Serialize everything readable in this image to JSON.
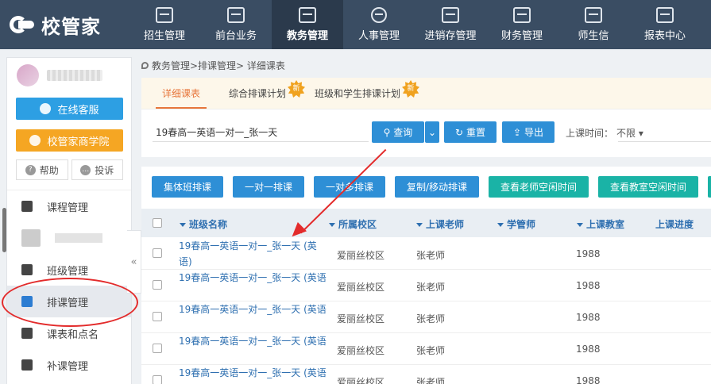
{
  "brand": {
    "name": "校管家"
  },
  "nav": [
    {
      "label": "招生管理",
      "icon": "user-card-icon"
    },
    {
      "label": "前台业务",
      "icon": "monitor-icon"
    },
    {
      "label": "教务管理",
      "icon": "book-icon",
      "active": true
    },
    {
      "label": "人事管理",
      "icon": "people-icon"
    },
    {
      "label": "进销存管理",
      "icon": "edit-box-icon"
    },
    {
      "label": "财务管理",
      "icon": "finance-icon"
    },
    {
      "label": "师生信",
      "icon": "chat-icon"
    },
    {
      "label": "报表中心",
      "icon": "chart-icon"
    }
  ],
  "sidebar": {
    "service_label": "在线客服",
    "academy_label": "校管家商学院",
    "help_label": "帮助",
    "complaint_label": "投诉",
    "items": [
      {
        "label": "课程管理",
        "icon": "course-icon"
      },
      {
        "label": "",
        "icon": "blurred-icon"
      },
      {
        "label": "班级管理",
        "icon": "class-icon"
      },
      {
        "label": "排课管理",
        "icon": "calendar-icon",
        "active": true
      },
      {
        "label": "课表和点名",
        "icon": "checklist-icon"
      },
      {
        "label": "补课管理",
        "icon": "makeup-icon"
      }
    ],
    "collapse_glyph": "«"
  },
  "breadcrumb": "教务管理>排课管理> 详细课表",
  "tabs": [
    {
      "label": "详细课表",
      "active": true,
      "new": false
    },
    {
      "label": "综合排课计划",
      "active": false,
      "new": true
    },
    {
      "label": "班级和学生排课计划",
      "active": false,
      "new": true
    }
  ],
  "new_badge": "新",
  "search": {
    "value": "19春高一英语一对一_张一天",
    "query_label": "查询",
    "reset_label": "重置",
    "export_label": "导出",
    "time_label": "上课时间：",
    "time_value": "不限"
  },
  "actions": [
    "集体班排课",
    "一对一排课",
    "一对多排课",
    "复制/移动排课",
    "查看老师空闲时间",
    "查看教室空闲时间"
  ],
  "table": {
    "headers": [
      "班级名称",
      "所属校区",
      "上课老师",
      "学管师",
      "上课教室",
      "上课进度"
    ],
    "rows": [
      {
        "name": "19春高一英语一对一_张一天 (英语)",
        "campus": "爱丽丝校区",
        "teacher": "张老师",
        "room": "1988"
      },
      {
        "name": "19春高一英语一对一_张一天 (英语",
        "campus": "爱丽丝校区",
        "teacher": "张老师",
        "room": "1988"
      },
      {
        "name": "19春高一英语一对一_张一天 (英语",
        "campus": "爱丽丝校区",
        "teacher": "张老师",
        "room": "1988"
      },
      {
        "name": "19春高一英语一对一_张一天 (英语",
        "campus": "爱丽丝校区",
        "teacher": "张老师",
        "room": "1988"
      },
      {
        "name": "19春高一英语一对一_张一天 (英语",
        "campus": "爱丽丝校区",
        "teacher": "张老师",
        "room": "1988"
      }
    ]
  },
  "colors": {
    "topbar": "#3a4d63",
    "primary": "#2e8fd6",
    "teal": "#1ab3a6",
    "accent": "#e7763b",
    "annotation": "#e32b2b"
  }
}
